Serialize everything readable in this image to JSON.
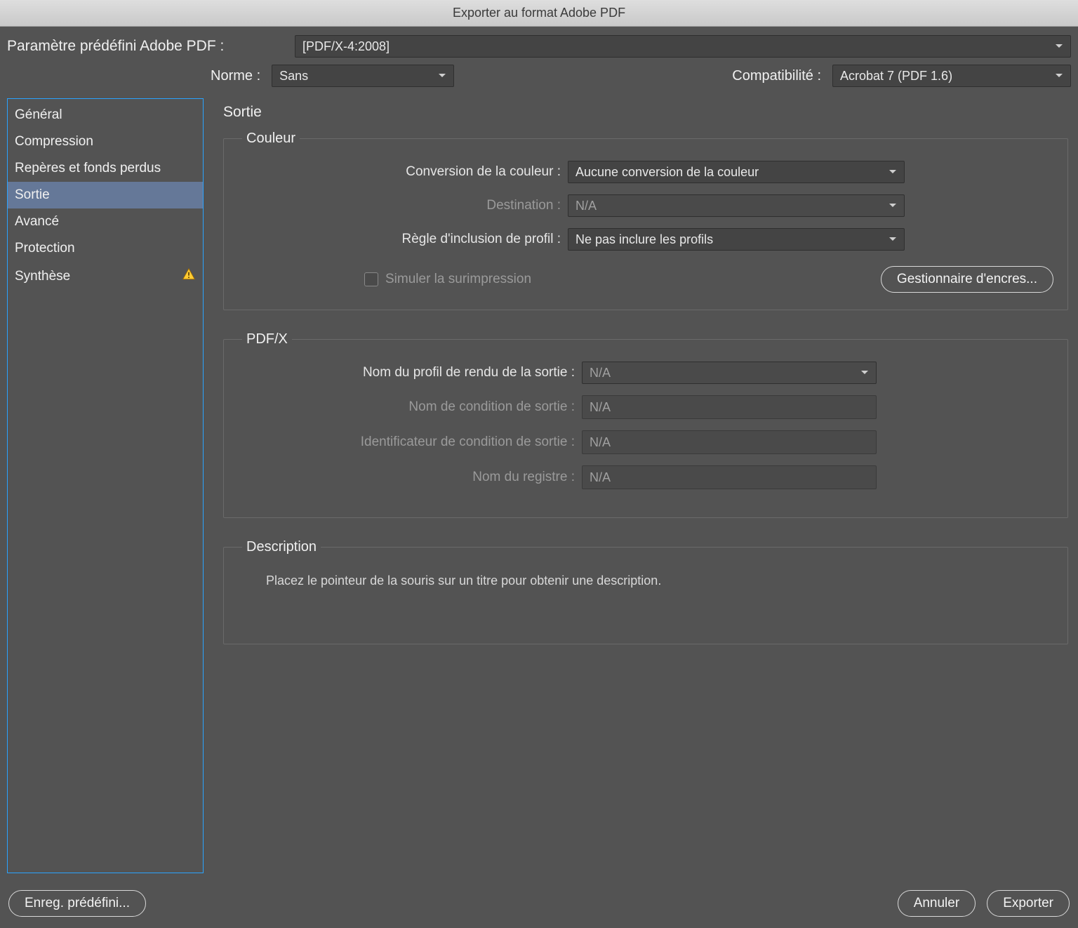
{
  "title": "Exporter au format Adobe PDF",
  "preset": {
    "label": "Paramètre prédéfini Adobe PDF :",
    "value": "[PDF/X-4:2008]"
  },
  "standard": {
    "label": "Norme  :",
    "value": "Sans"
  },
  "compatibility": {
    "label": "Compatibilité :",
    "value": "Acrobat 7 (PDF 1.6)"
  },
  "sidebar": {
    "items": [
      {
        "label": "Général",
        "active": false,
        "warn": false
      },
      {
        "label": "Compression",
        "active": false,
        "warn": false
      },
      {
        "label": "Repères et fonds perdus",
        "active": false,
        "warn": false
      },
      {
        "label": "Sortie",
        "active": true,
        "warn": false
      },
      {
        "label": "Avancé",
        "active": false,
        "warn": false
      },
      {
        "label": "Protection",
        "active": false,
        "warn": false
      },
      {
        "label": "Synthèse",
        "active": false,
        "warn": true
      }
    ]
  },
  "main": {
    "title": "Sortie",
    "color": {
      "legend": "Couleur",
      "conversion_label": "Conversion de la couleur :",
      "conversion_value": "Aucune conversion de la couleur",
      "destination_label": "Destination :",
      "destination_value": "N/A",
      "policy_label": "Règle d'inclusion de profil :",
      "policy_value": "Ne pas inclure les profils",
      "simulate_label": "Simuler la surimpression",
      "ink_manager": "Gestionnaire d'encres..."
    },
    "pdfx": {
      "legend": "PDF/X",
      "output_profile_label": "Nom du profil de rendu de la sortie :",
      "output_profile_value": "N/A",
      "condition_name_label": "Nom de condition de sortie :",
      "condition_name_value": "N/A",
      "condition_id_label": "Identificateur de condition de sortie :",
      "condition_id_value": "N/A",
      "registry_label": "Nom du registre :",
      "registry_value": "N/A"
    },
    "description": {
      "legend": "Description",
      "text": "Placez le pointeur de la souris sur un titre pour obtenir une description."
    }
  },
  "footer": {
    "save_preset": "Enreg. prédéfini...",
    "cancel": "Annuler",
    "export": "Exporter"
  }
}
